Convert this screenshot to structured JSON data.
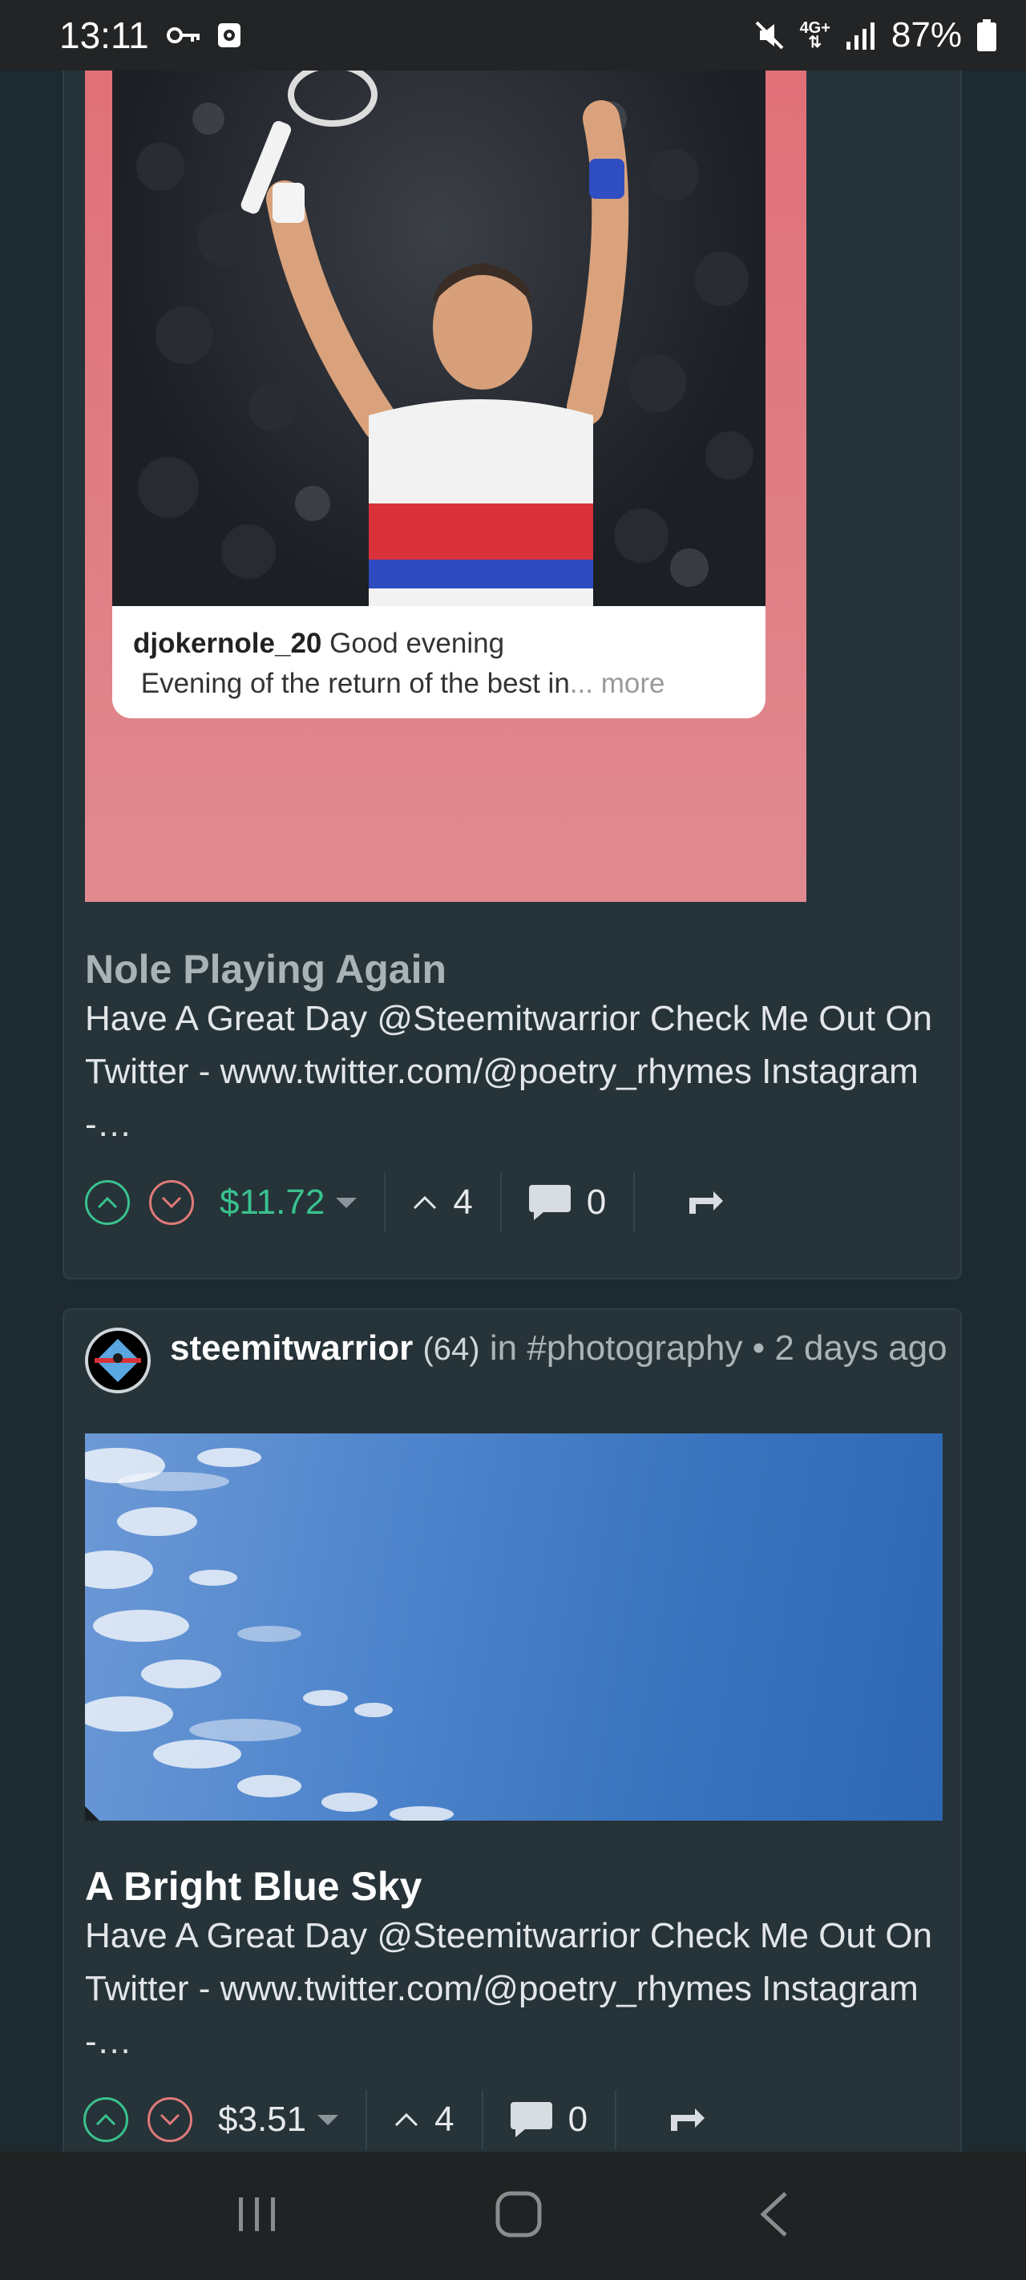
{
  "status_bar": {
    "time": "13:11",
    "network": "4G+",
    "battery": "87%"
  },
  "posts": [
    {
      "image_caption": {
        "username": "djokernole_20",
        "line1": "Good evening",
        "line2": "Evening of the return of the best in",
        "more": "... more"
      },
      "title": "Nole Playing Again",
      "excerpt": "Have A Great Day @Steemitwarrior Check Me Out On Twitter - www.twitter.com/@poetry_rhymes Instagram -…",
      "payout": "$11.72",
      "payout_color": "#39c28e",
      "votes": "4",
      "comments": "0"
    },
    {
      "author": "steemitwarrior",
      "reputation": "(64)",
      "in_label": "in",
      "community": "#photography",
      "time_ago": "• 2 days ago",
      "title": "A Bright Blue Sky",
      "excerpt": "Have A Great Day @Steemitwarrior Check Me Out On Twitter - www.twitter.com/@poetry_rhymes Instagram -…",
      "payout": "$3.51",
      "payout_color": "#e6e9ea",
      "votes": "4",
      "comments": "0"
    }
  ],
  "icons": {
    "upvote": "chevron-up-circle-icon",
    "downvote": "chevron-down-circle-icon",
    "comment": "speech-bubble-icon",
    "reblog": "reblog-icon"
  }
}
